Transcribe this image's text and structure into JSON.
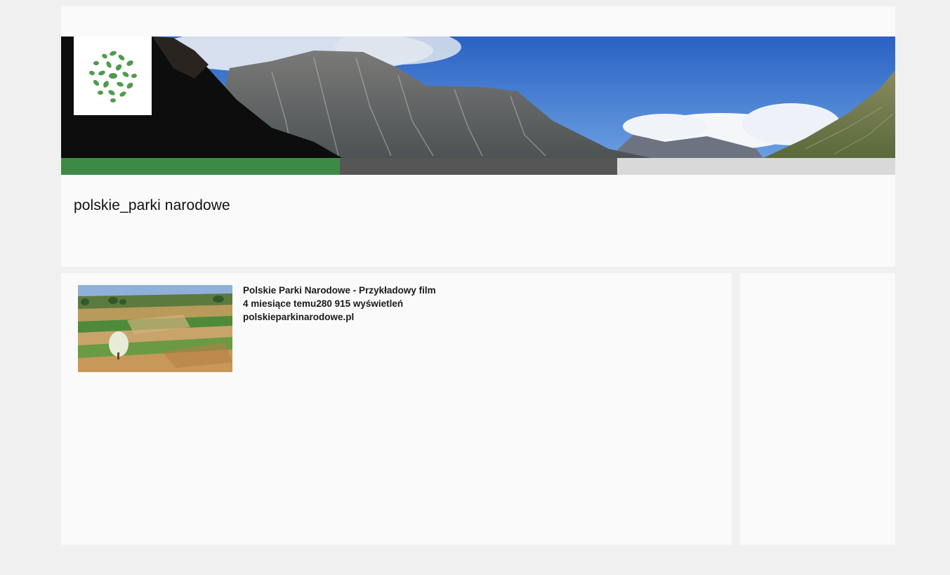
{
  "channel": {
    "title": "polskie_parki narodowe"
  },
  "icons": {
    "logo": "green-leaves-logo-icon",
    "banner": "tatra-mountains-banner"
  },
  "colors": {
    "background": "#f0f0f0",
    "panel": "#fafafa",
    "stripe_green": "#3d8a45",
    "stripe_dark": "#565656",
    "stripe_light": "#d9d9d9"
  },
  "videos": [
    {
      "title": "Polskie Parki Narodowe - Przykładowy film",
      "age": "4 miesiące temu",
      "views": "280 915 wyświetleń",
      "url": "polskieparkinarodowe.pl",
      "thumbnail": "fields-landscape-thumbnail"
    }
  ]
}
